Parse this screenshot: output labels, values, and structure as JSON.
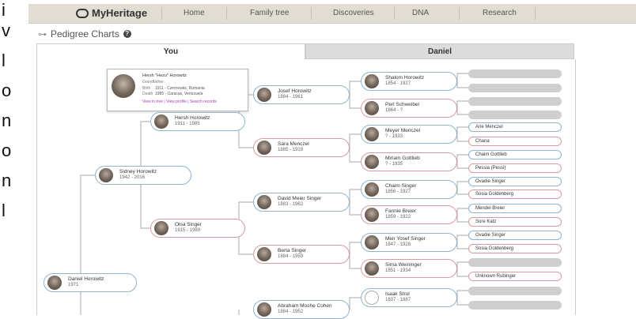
{
  "left_fragment": [
    "i",
    "v",
    "l",
    "o",
    "n",
    "o",
    "n",
    "l"
  ],
  "header": {
    "logo": "MyHeritage",
    "nav": [
      "Home",
      "Family tree",
      "Discoveries",
      "DNA",
      "Research"
    ]
  },
  "page": {
    "title": "Pedigree Charts"
  },
  "tabs": {
    "you": "You",
    "daniel": "Daniel"
  },
  "popup": {
    "name": "Hersh \"Hezu\" Horowitz",
    "relation": "Grandfather",
    "birth_label": "Birth",
    "birth": "1911 - Czernowitz, Romania",
    "death_label": "Death",
    "death": "1985 - Caracas, Venezuela",
    "links": "View in tree | View profile | Search records"
  },
  "people": {
    "daniel": {
      "name": "Daniel Horowitz",
      "years": "1971"
    },
    "sidney": {
      "name": "Sidney Horowitz",
      "years": "1942 - 2016"
    },
    "hersh": {
      "name": "Hersh Horowitz",
      "years": "1911 - 1985"
    },
    "olsa": {
      "name": "Olsa Singer",
      "years": "1915 - 1989"
    },
    "josef": {
      "name": "Josef Horowitz",
      "years": "1884 - 1961"
    },
    "sara": {
      "name": "Sara Menczel",
      "years": "1885 - 1919"
    },
    "david": {
      "name": "David Meier Singer",
      "years": "1883 - 1962"
    },
    "berta": {
      "name": "Berta Singer",
      "years": "1884 - 1959"
    },
    "abraham": {
      "name": "Abraham Moshe Cohen",
      "years": "1884 - 1952"
    },
    "shalom": {
      "name": "Shalom Horowitz",
      "years": "1854 - 1927"
    },
    "perl": {
      "name": "Perl Schweibel",
      "years": "1864 - ?"
    },
    "meyer": {
      "name": "Meyer Menczel",
      "years": "? - 1933"
    },
    "miriam": {
      "name": "Miriam Gottlieb",
      "years": "? - 1935"
    },
    "chaim": {
      "name": "Chaim Singer",
      "years": "1856 - 1927"
    },
    "fannie": {
      "name": "Fannie Breier",
      "years": "1859 - 1922"
    },
    "meir": {
      "name": "Meir Yosef Singer",
      "years": "1847 - 1928"
    },
    "sima": {
      "name": "Sima Weininger",
      "years": "1851 - 1934"
    },
    "isaak": {
      "name": "Isaak Strul",
      "years": "1837 - 1887"
    }
  },
  "gen5": [
    "Arie Menczel",
    "Chana",
    "Chaim Gottlieb",
    "Pessia (Pessi)",
    "Ovadie Singer",
    "Sosia Goldenberg",
    "Mendel Breier",
    "Sure Katz",
    "Ovadie Singer",
    "Sosia Goldenberg",
    "Unknown Rubinger"
  ]
}
